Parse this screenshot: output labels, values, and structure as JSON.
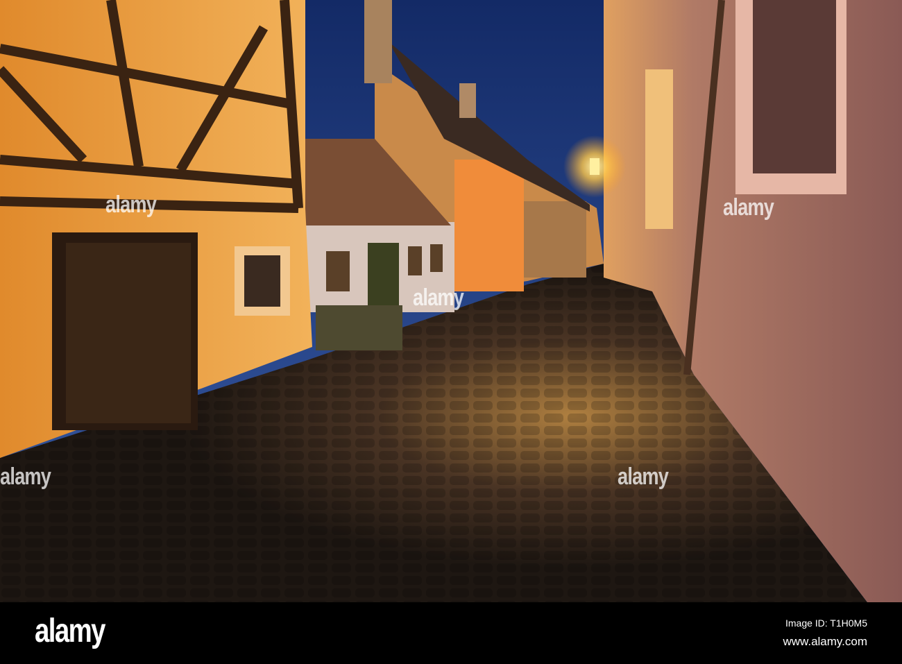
{
  "watermark": {
    "brand": "alamy"
  },
  "footer": {
    "logo": "alamy",
    "image_id": "Image ID: T1H0M5",
    "url": "www.alamy.com"
  },
  "colors": {
    "sky": "#1e3a78",
    "lamp": "#ffd66a",
    "wall_left": "#e8962f",
    "wall_right": "#a86f62",
    "cobble": "#3a2c22"
  }
}
